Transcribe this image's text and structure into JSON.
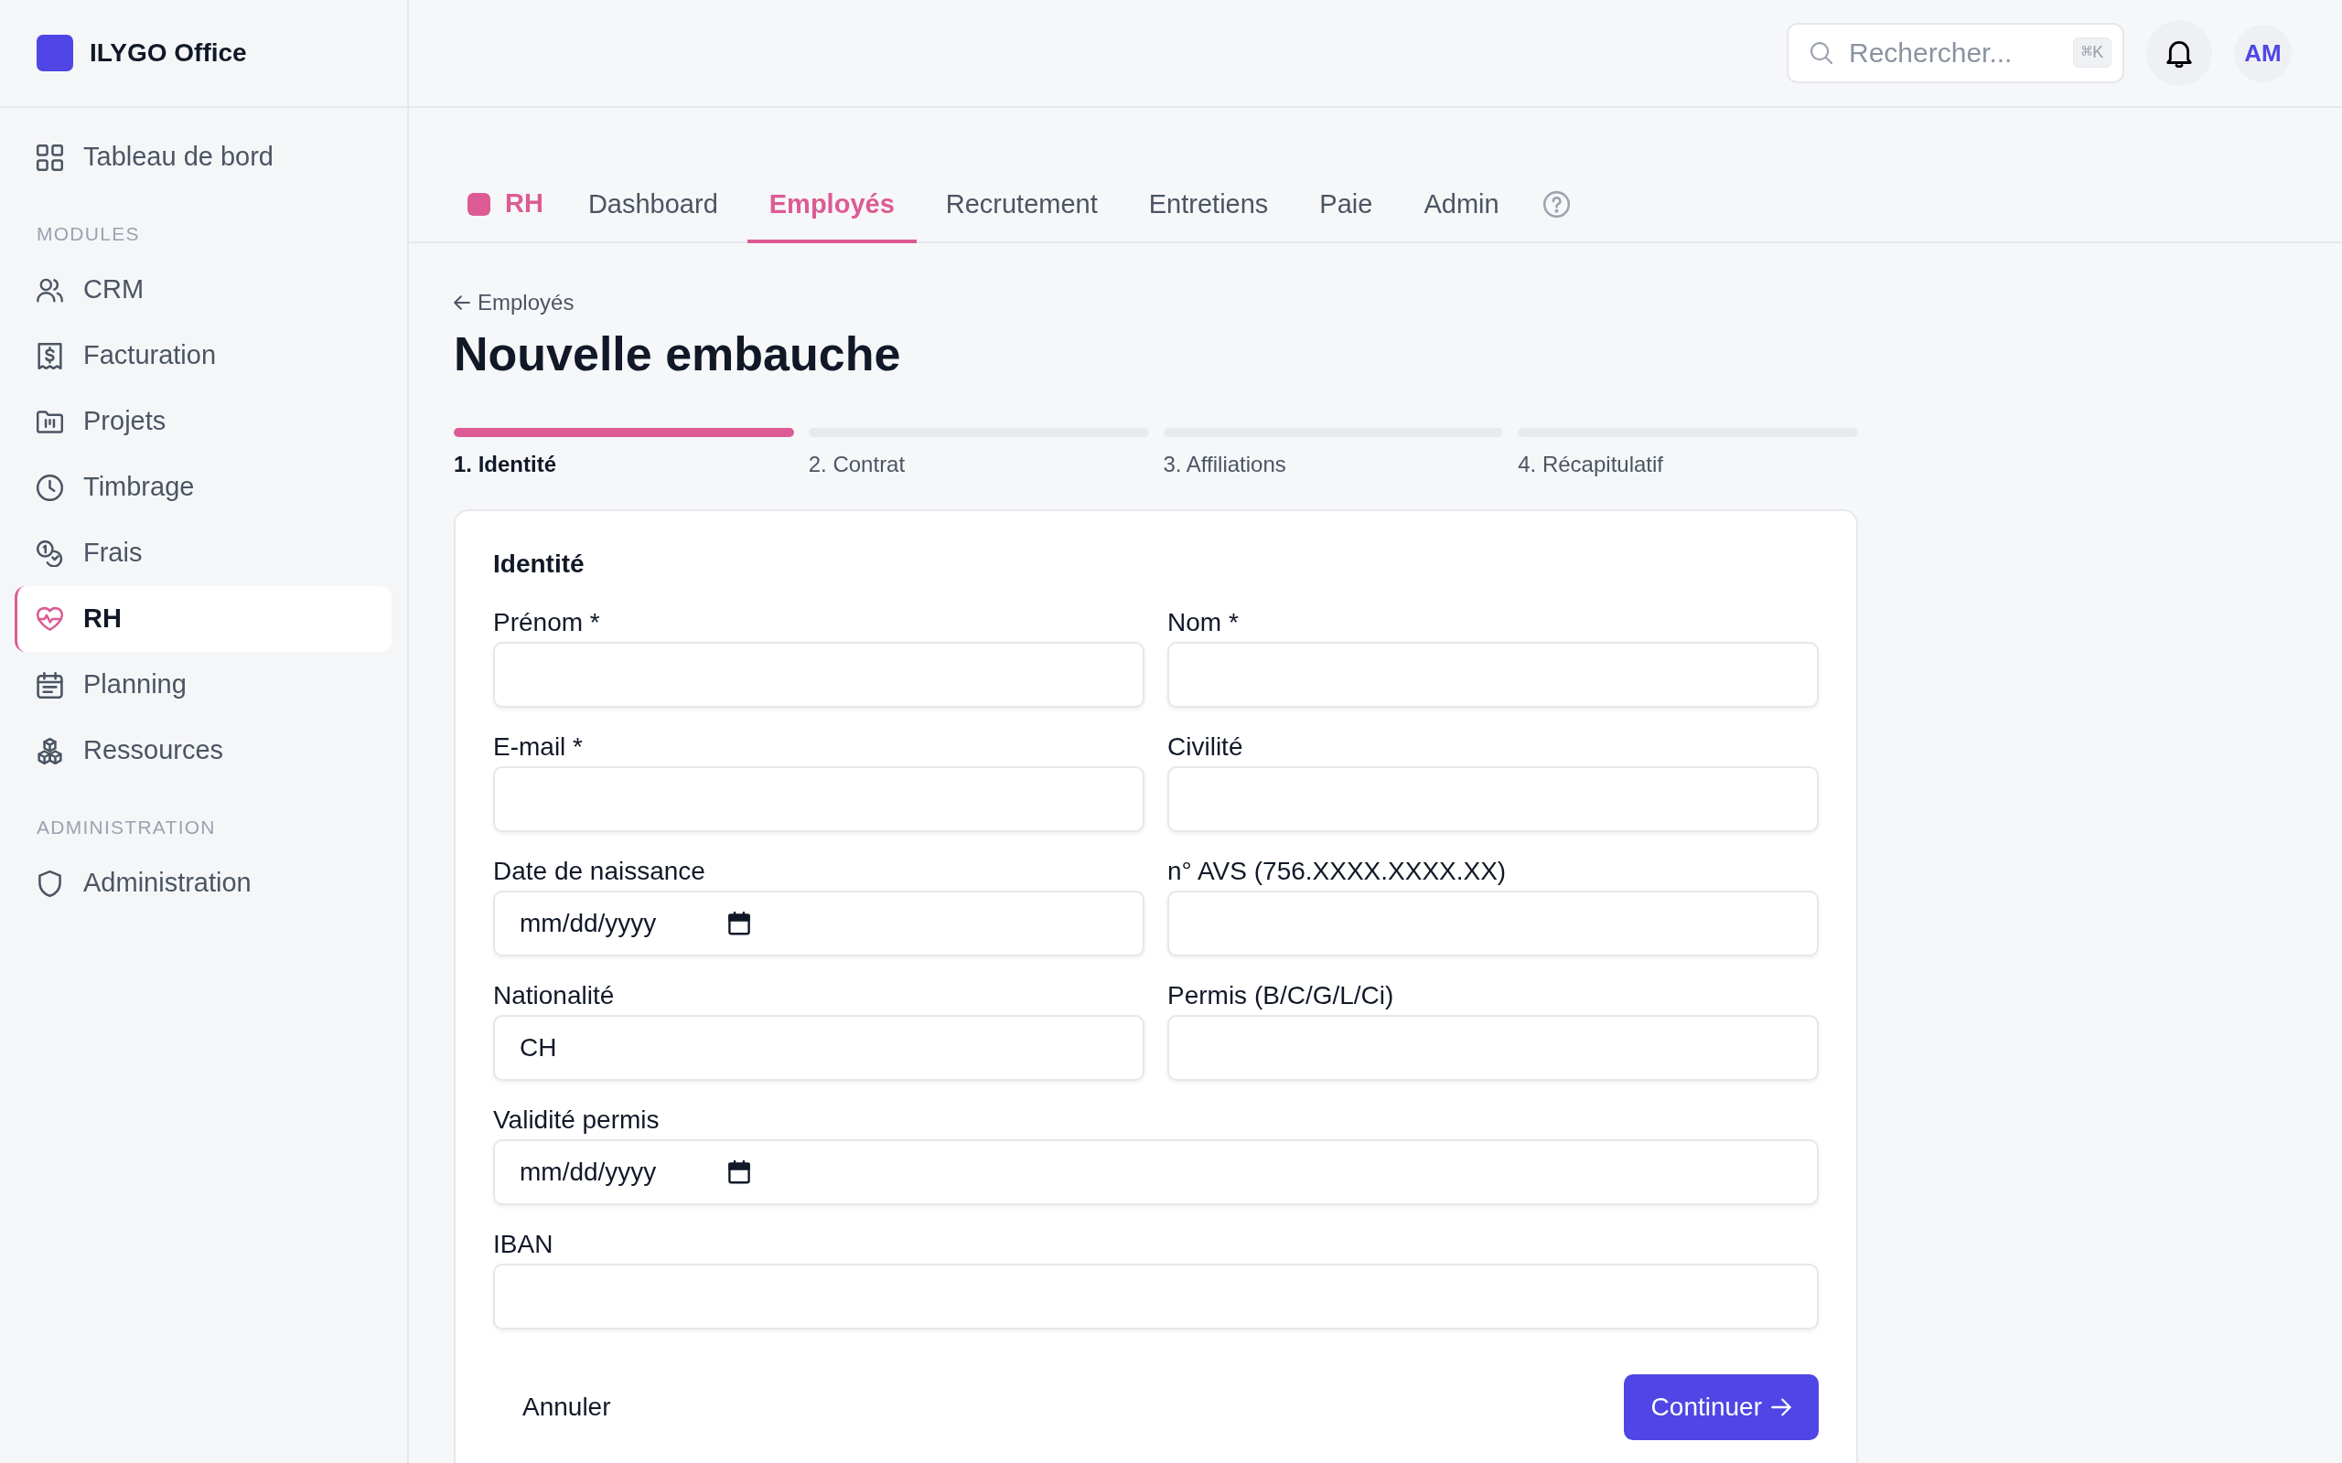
{
  "app": {
    "name": "ILYGO Office"
  },
  "sidebar": {
    "sections": [
      {
        "items": [
          {
            "label": "Tableau de bord",
            "selected": false
          }
        ]
      },
      {
        "heading": "MODULES",
        "items": [
          {
            "label": "CRM",
            "selected": false
          },
          {
            "label": "Facturation",
            "selected": false
          },
          {
            "label": "Projets",
            "selected": false
          },
          {
            "label": "Timbrage",
            "selected": false
          },
          {
            "label": "Frais",
            "selected": false
          },
          {
            "label": "RH",
            "selected": true
          },
          {
            "label": "Planning",
            "selected": false
          },
          {
            "label": "Ressources",
            "selected": false
          }
        ]
      },
      {
        "heading": "ADMINISTRATION",
        "items": [
          {
            "label": "Administration",
            "selected": false
          }
        ]
      }
    ]
  },
  "top_bar": {
    "search": {
      "placeholder": "Rechercher...",
      "shortcut": "⌘K"
    },
    "avatar": {
      "initials": "AM"
    }
  },
  "module_nav": {
    "title": "RH",
    "tabs": [
      {
        "label": "Dashboard",
        "selected": false
      },
      {
        "label": "Employés",
        "selected": true
      },
      {
        "label": "Recrutement",
        "selected": false
      },
      {
        "label": "Entretiens",
        "selected": false
      },
      {
        "label": "Paie",
        "selected": false
      },
      {
        "label": "Admin",
        "selected": false
      }
    ]
  },
  "page": {
    "back_link": "Employés",
    "title": "Nouvelle embauche"
  },
  "steps": [
    {
      "label": "1. Identité",
      "selected": true
    },
    {
      "label": "2. Contrat",
      "selected": false
    },
    {
      "label": "3. Affiliations",
      "selected": false
    },
    {
      "label": "4. Récapitulatif",
      "selected": false
    }
  ],
  "form": {
    "section_title": "Identité",
    "rows": [
      {
        "fields": [
          {
            "label": "Prénom *",
            "kind": "text"
          },
          {
            "label": "Nom *",
            "kind": "text"
          }
        ]
      },
      {
        "fields": [
          {
            "label": "E-mail *",
            "kind": "text"
          },
          {
            "label": "Civilité",
            "kind": "text"
          }
        ]
      },
      {
        "fields": [
          {
            "label": "Date de naissance",
            "kind": "date",
            "placeholder": "mm/dd/yyyy"
          },
          {
            "label": "n° AVS (756.XXXX.XXXX.XX)",
            "kind": "text"
          }
        ]
      },
      {
        "fields": [
          {
            "label": "Nationalité",
            "kind": "text",
            "value": "CH"
          },
          {
            "label": "Permis (B/C/G/L/Ci)",
            "kind": "text"
          }
        ]
      },
      {
        "fields": [
          {
            "label": "Validité permis",
            "kind": "date",
            "placeholder": "mm/dd/yyyy"
          }
        ]
      },
      {
        "fields": [
          {
            "label": "IBAN",
            "kind": "text"
          }
        ]
      }
    ],
    "actions": {
      "cancel": "Annuler",
      "submit": "Continuer"
    }
  }
}
